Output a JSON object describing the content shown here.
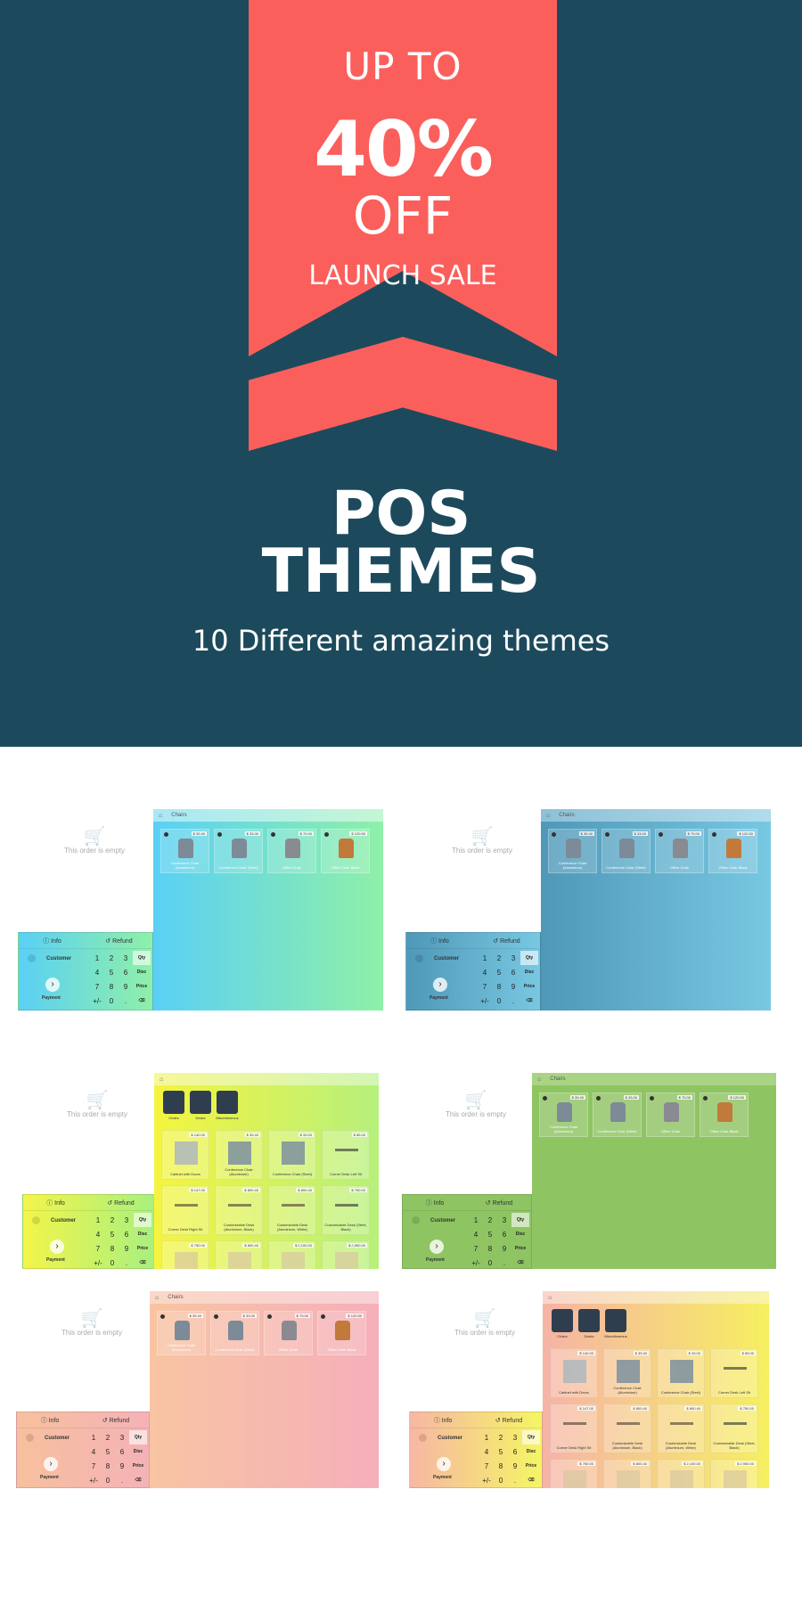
{
  "hero": {
    "badge_line1": "UP TO",
    "badge_percent": "40%",
    "badge_line3": "OFF",
    "badge_line4": "LAUNCH SALE",
    "title_line1": "POS",
    "title_line2": "THEMES",
    "subtitle": "10 Different amazing themes"
  },
  "colors": {
    "hero_background": "#1c4a5c",
    "ribbon": "#fb5f5c"
  },
  "pos": {
    "empty_text": "This order is empty",
    "info_label": "Info",
    "refund_label": "Refund",
    "customer_label": "Customer",
    "payment_label": "Payment",
    "breadcrumb": "Chairs",
    "keypad": [
      "1",
      "2",
      "3",
      "Qty",
      "4",
      "5",
      "6",
      "Disc",
      "7",
      "8",
      "9",
      "Price",
      "+/-",
      "0",
      ".",
      "⌫"
    ],
    "chair_products": [
      {
        "name": "Conference Chair (Aluminium)",
        "price": "$ 39.40"
      },
      {
        "name": "Conference Chair (Steel)",
        "price": "$ 33.00"
      },
      {
        "name": "Office Chair",
        "price": "$ 70.00"
      },
      {
        "name": "Office Chair Black",
        "price": "$ 120.50"
      }
    ],
    "categories": [
      "Chairs",
      "Desks",
      "Miscellaneous"
    ],
    "all_products": [
      {
        "name": "Cabinet with Doors",
        "price": "$ 140.00"
      },
      {
        "name": "Conference Chair (Aluminium)",
        "price": "$ 39.40"
      },
      {
        "name": "Conference Chair (Steel)",
        "price": "$ 33.00"
      },
      {
        "name": "Corner Desk Left Sit",
        "price": "$ 85.00"
      },
      {
        "name": "Corner Desk Right Sit",
        "price": "$ 147.00"
      },
      {
        "name": "Customizable Desk (Aluminium, Black)",
        "price": "$ 800.40"
      },
      {
        "name": "Customizable Desk (Aluminium, White)",
        "price": "$ 800.40"
      },
      {
        "name": "Customizable Desk (Steel, Black)",
        "price": "$ 750.00"
      }
    ],
    "all_products_partial_prices": [
      "$ 750.00",
      "$ 800.40",
      "$ 2,100.00",
      "$ 2,950.00"
    ]
  }
}
